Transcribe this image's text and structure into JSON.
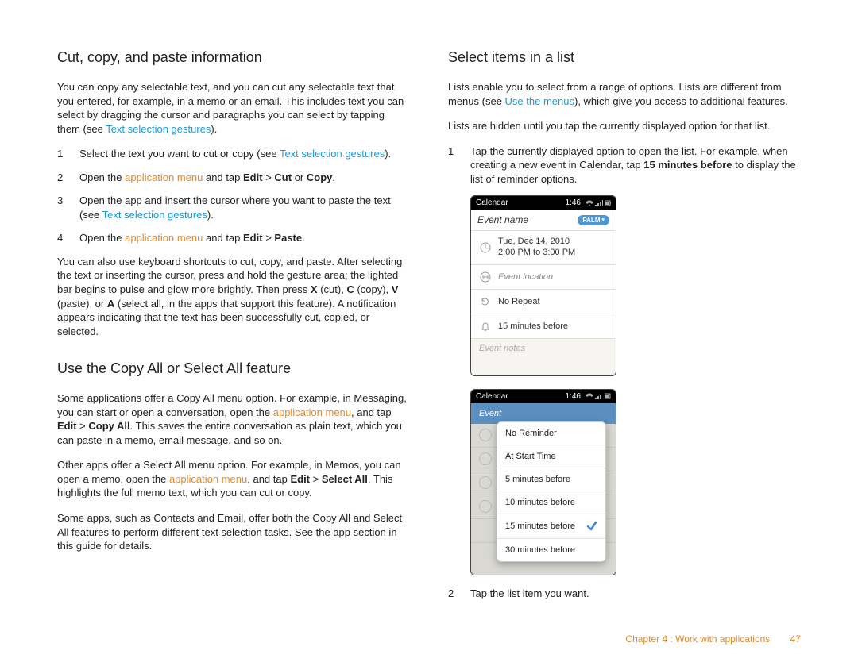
{
  "left": {
    "h_cut": "Cut, copy, and paste information",
    "p1a": "You can copy any selectable text, and you can cut any selectable text that you entered, for example, in a memo or an email. This includes text you can select by dragging the cursor and paragraphs you can select by tapping them (see ",
    "p1link": "Text selection gestures",
    "p1b": ").",
    "step1_num": "1",
    "step1a": "Select the text you want to cut or copy (see ",
    "step1link": "Text selection gestures",
    "step1b": ").",
    "step2_num": "2",
    "step2a": "Open the ",
    "step2link": "application menu",
    "step2b": " and tap ",
    "step2c": "Edit",
    "step2d": " > ",
    "step2e": "Cut",
    "step2f": " or ",
    "step2g": "Copy",
    "step2h": ".",
    "step3_num": "3",
    "step3a": "Open the app and insert the cursor where you want to paste the text (see ",
    "step3link": "Text selection gestures",
    "step3b": ").",
    "step4_num": "4",
    "step4a": "Open the ",
    "step4link": "application menu",
    "step4b": " and tap ",
    "step4c": "Edit",
    "step4d": " > ",
    "step4e": "Paste",
    "step4f": ".",
    "p_short": "You can also use keyboard shortcuts to cut, copy, and paste. After selecting the text or inserting the cursor, press and hold the gesture area; the lighted bar begins to pulse and glow more brightly. Then press ",
    "p_short_x": "X",
    "p_short_cut": " (cut), ",
    "p_short_c": "C",
    "p_short_copy": " (copy), ",
    "p_short_v": "V",
    "p_short_paste": " (paste), or ",
    "p_short_a": "A",
    "p_short_rest": " (select all, in the apps that support this feature). A notification appears indicating that the text has been successfully cut, copied, or selected.",
    "h_copyall": "Use the Copy All or Select All feature",
    "p_ca1a": "Some applications offer a Copy All menu option. For example, in Messaging, you can start or open a conversation, open the ",
    "p_ca1link": "application menu",
    "p_ca1b": ", and tap ",
    "p_ca1c": "Edit",
    "p_ca1d": " > ",
    "p_ca1e": "Copy All",
    "p_ca1f": ". This saves the entire conversation as plain text, which you can paste in a memo, email message, and so on.",
    "p_ca2a": "Other apps offer a Select All menu option. For example, in Memos, you can open a memo, open the ",
    "p_ca2link": "application menu",
    "p_ca2b": ", and tap ",
    "p_ca2c": "Edit",
    "p_ca2d": " > ",
    "p_ca2e": "Select All",
    "p_ca2f": ". This highlights the full memo text, which you can cut or copy.",
    "p_ca3": "Some apps, such as Contacts and Email, offer both the Copy All and Select All features to perform different text selection tasks. See the app section in this guide for details."
  },
  "right": {
    "h_select": "Select items in a list",
    "p1a": "Lists enable you to select from a range of options. Lists are different from menus (see ",
    "p1link": "Use the menus",
    "p1b": "), which give you access to additional features.",
    "p2": "Lists are hidden until you tap the currently displayed option for that list.",
    "step1_num": "1",
    "step1a": "Tap the currently displayed option to open the list. For example, when creating a new event in Calendar, tap ",
    "step1b": "15 minutes before",
    "step1c": " to display the list of reminder options.",
    "phone1": {
      "title": "Calendar",
      "time": "1:46",
      "event_name": "Event name",
      "palm": "PALM",
      "date_line1": "Tue, Dec 14, 2010",
      "date_line2": "2:00 PM to 3:00 PM",
      "location": "Event location",
      "repeat": "No Repeat",
      "reminder": "15 minutes before",
      "notes": "Event notes"
    },
    "phone2": {
      "title": "Calendar",
      "time": "1:46",
      "event_label": "Event",
      "options": [
        "No Reminder",
        "At Start Time",
        "5 minutes before",
        "10 minutes before",
        "15 minutes before",
        "30 minutes before"
      ],
      "checked_index": 4
    },
    "step2_num": "2",
    "step2": "Tap the list item you want."
  },
  "footer": {
    "chapter": "Chapter 4 : Work with applications",
    "page": "47"
  }
}
